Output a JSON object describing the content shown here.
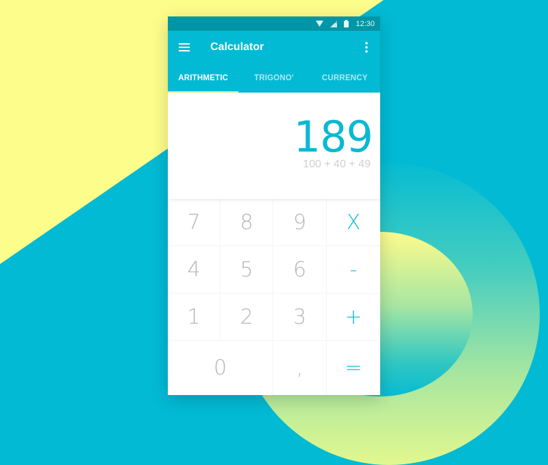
{
  "status_bar": {
    "time": "12:30",
    "icons": [
      "wifi-icon",
      "cell-signal-icon",
      "battery-icon"
    ]
  },
  "app_bar": {
    "title": "Calculator",
    "menu_icon": "hamburger-menu-icon",
    "more_icon": "more-vert-icon"
  },
  "tabs": [
    {
      "label": "ARITHMETIC",
      "active": true
    },
    {
      "label": "TRIGONO'",
      "active": false
    },
    {
      "label": "CURRENCY",
      "active": false
    }
  ],
  "display": {
    "result": "189",
    "expression": "100 + 40 + 49"
  },
  "keypad": {
    "rows": [
      [
        "7",
        "8",
        "9",
        "X"
      ],
      [
        "4",
        "5",
        "6",
        "-"
      ],
      [
        "1",
        "2",
        "3",
        "+"
      ],
      [
        "0",
        ",",
        "="
      ]
    ]
  },
  "colors": {
    "primary": "#02bad4",
    "primary_dark": "#0096a6",
    "background_yellow": "#fdfd8b",
    "indicator": "#d6f08e",
    "operator": "#16bcd4",
    "digit": "#b5b5b5"
  }
}
